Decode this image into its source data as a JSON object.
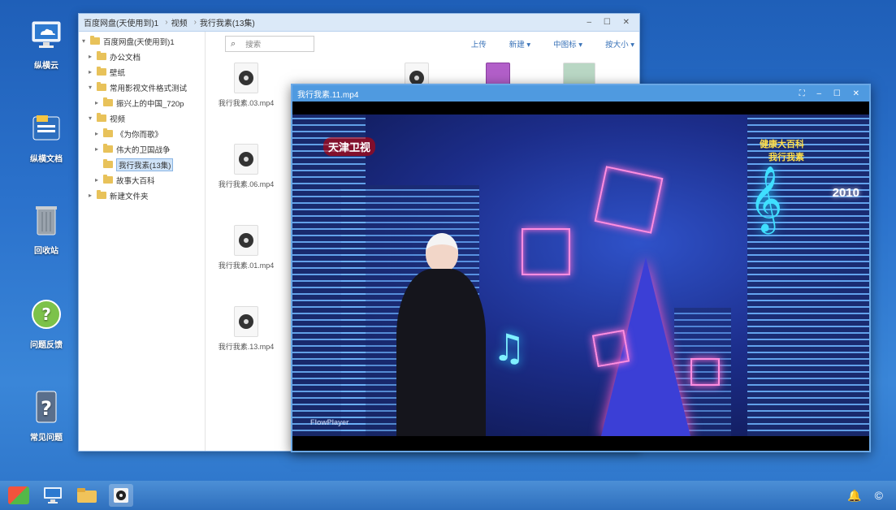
{
  "desktop": {
    "icons": [
      {
        "label": "纵横云",
        "icon": "cloud-monitor-icon"
      },
      {
        "label": "纵横文档",
        "icon": "documents-icon"
      },
      {
        "label": "回收站",
        "icon": "trash-icon"
      },
      {
        "label": "问题反馈",
        "icon": "help-icon"
      },
      {
        "label": "常见问题",
        "icon": "question-icon"
      }
    ]
  },
  "explorer": {
    "breadcrumb": [
      "百度网盘(天使用到)1",
      "视频",
      "我行我素(13集)"
    ],
    "search_placeholder": "搜索",
    "toolbar": {
      "upload": "上传",
      "new": "新建 ▾",
      "sort": "中图标 ▾",
      "size": "按大小 ▾"
    },
    "tree": [
      {
        "label": "百度网盘(天使用到)1",
        "arrow": "▾",
        "level": 0
      },
      {
        "label": "办公文档",
        "arrow": "▸",
        "level": 1
      },
      {
        "label": "壁纸",
        "arrow": "▸",
        "level": 1
      },
      {
        "label": "常用影视文件格式测试",
        "arrow": "▾",
        "level": 1
      },
      {
        "label": "振兴上的中国_720p",
        "arrow": "▸",
        "level": 2
      },
      {
        "label": "视频",
        "arrow": "▾",
        "level": 1
      },
      {
        "label": "《为你而歌》",
        "arrow": "▸",
        "level": 2
      },
      {
        "label": "伟大的卫国战争",
        "arrow": "▸",
        "level": 2
      },
      {
        "label": "我行我素(13集)",
        "arrow": "",
        "level": 2,
        "selected": true
      },
      {
        "label": "故事大百科",
        "arrow": "▸",
        "level": 2
      },
      {
        "label": "新建文件夹",
        "arrow": "▸",
        "level": 1
      }
    ],
    "files": [
      {
        "name": "我行我素.03.mp4"
      },
      {
        "name": "我行我素.06.mp4"
      },
      {
        "name": "我行我素.01.mp4"
      },
      {
        "name": "我行我素.13.mp4"
      }
    ]
  },
  "player": {
    "title": "我行我素.11.mp4",
    "controls": "⛶ – ☐ ✕",
    "overlay": {
      "logo": "天津卫视",
      "caption_line1": "健康大百科",
      "caption_line2": "我行我素",
      "year": "2010",
      "watermark": "FlowPlayer"
    }
  },
  "explorer_window_controls": "– ☐ ✕",
  "taskbar": {
    "tray": "🔔 ©"
  }
}
